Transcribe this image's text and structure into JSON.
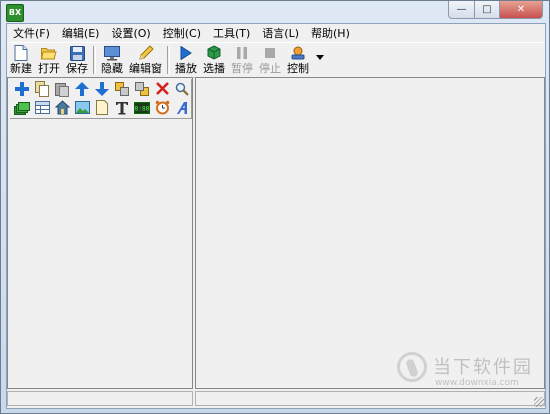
{
  "app": {
    "icon_text": "BX"
  },
  "window_buttons": {
    "minimize": "—",
    "maximize": "□",
    "close": "✕"
  },
  "menu": [
    {
      "label": "文件(F)"
    },
    {
      "label": "编辑(E)"
    },
    {
      "label": "设置(O)"
    },
    {
      "label": "控制(C)"
    },
    {
      "label": "工具(T)"
    },
    {
      "label": "语言(L)"
    },
    {
      "label": "帮助(H)"
    }
  ],
  "toolbar": {
    "new": "新建",
    "open": "打开",
    "save": "保存",
    "hide": "隐藏",
    "edit_window": "编辑窗",
    "play": "播放",
    "select_play": "选播",
    "pause": "暂停",
    "stop": "停止",
    "control": "控制"
  },
  "icon_grid": {
    "row1": [
      "add-icon",
      "copy-icon",
      "paste-icon",
      "move-up-icon",
      "move-down-icon",
      "bring-forward-icon",
      "send-backward-icon",
      "delete-icon",
      "zoom-icon"
    ],
    "row2": [
      "layers-icon",
      "table-icon",
      "home-icon",
      "image-icon",
      "document-icon",
      "text-icon",
      "clock-display-icon",
      "alarm-clock-icon",
      "font-icon"
    ]
  },
  "watermark": {
    "text": "当下软件园",
    "url": "www.downxia.com"
  },
  "colors": {
    "accent_blue": "#1f6fd1",
    "delete_red": "#d42020",
    "icon_green": "#2d8f2d"
  }
}
